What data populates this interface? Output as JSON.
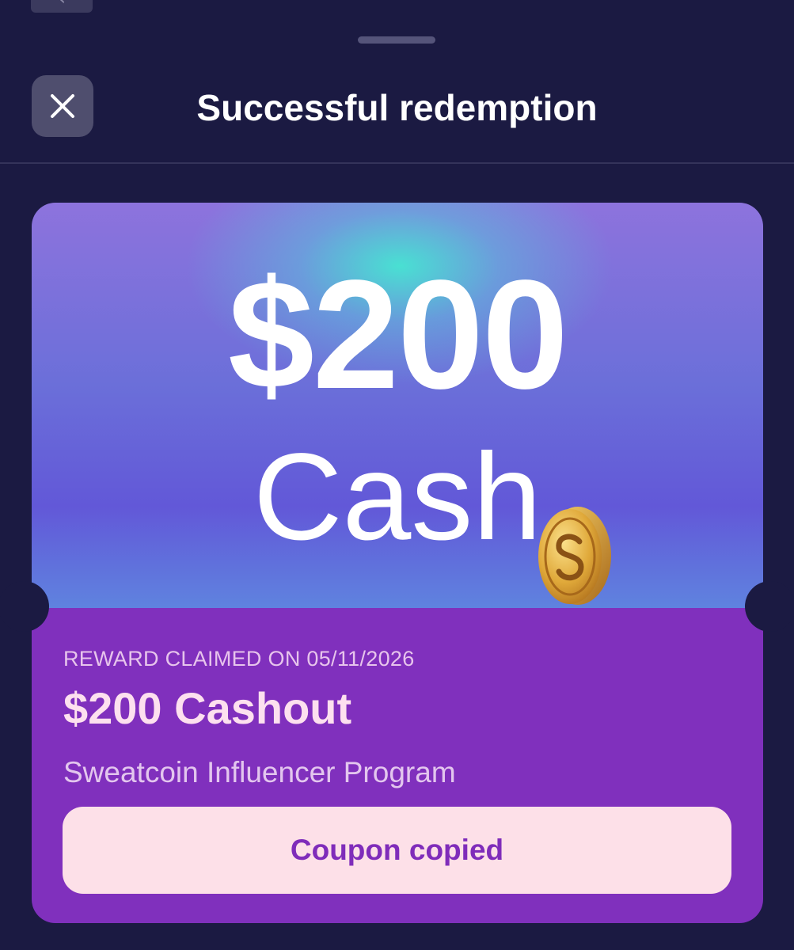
{
  "sheet": {
    "title": "Successful redemption",
    "close_icon": "close-icon",
    "behind_back_icon": "chevron-left-icon",
    "behind_back_glyph": "‹"
  },
  "card": {
    "hero_amount": "$200",
    "hero_word": "Cash",
    "coin_icon": "sweatcoin-coin-icon",
    "claimed_label": "REWARD CLAIMED ON 05/11/2026",
    "reward_title": "$200 Cashout",
    "reward_subtitle": "Sweatcoin Influencer Program",
    "coupon_button_label": "Coupon copied"
  },
  "colors": {
    "background": "#1b1a42",
    "card_info": "#8030bd",
    "button_bg": "#fde0e8",
    "button_text": "#7f2cba"
  }
}
